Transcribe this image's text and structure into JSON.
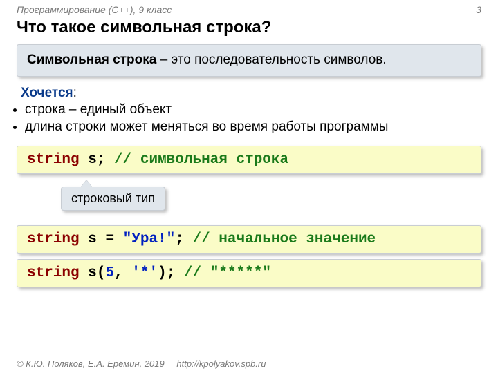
{
  "header": {
    "course": "Программирование (C++), 9 класс",
    "page": "3"
  },
  "title": "Что такое символьная строка?",
  "definition": {
    "term": "Символьная строка",
    "rest": " – это последовательность символов."
  },
  "wants": {
    "label": "Хочется",
    "colon": ":",
    "items": [
      "строка – единый объект",
      "длина строки может меняться во время работы программы"
    ]
  },
  "code1": {
    "kw": "string",
    "id": " s",
    "semi": "; ",
    "cm": "// символьная строка"
  },
  "callout": "строковый тип",
  "code2": {
    "kw": "string",
    "id": " s ",
    "eq": "= ",
    "str": "\"Ура!\"",
    "semi": "; ",
    "cm": "// начальное значение"
  },
  "code3": {
    "kw": "string",
    "id": " s",
    "lp": "(",
    "num": "5",
    "comma": ", ",
    "chr": "'*'",
    "rp": ")",
    "semi": "; ",
    "cm": "// \"*****\""
  },
  "footer": {
    "copyright": "© К.Ю. Поляков, Е.А. Ерёмин, 2019",
    "url": "http://kpolyakov.spb.ru"
  }
}
